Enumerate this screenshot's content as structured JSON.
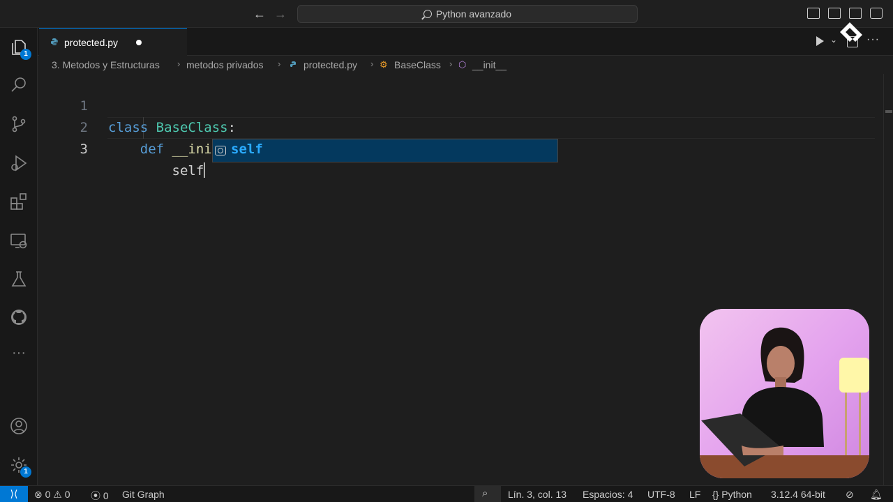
{
  "titlebar": {
    "search_text": "Python avanzado",
    "back_icon": "arrow-left-icon",
    "forward_icon": "arrow-right-icon"
  },
  "activity_bar": {
    "items": [
      {
        "name": "explorer-icon",
        "badge": "1"
      },
      {
        "name": "search-icon"
      },
      {
        "name": "source-control-icon"
      },
      {
        "name": "run-debug-icon"
      },
      {
        "name": "extensions-icon"
      },
      {
        "name": "remote-explorer-icon"
      },
      {
        "name": "testing-icon"
      },
      {
        "name": "github-icon"
      },
      {
        "name": "more-icon",
        "label": "···"
      }
    ],
    "bottom": [
      {
        "name": "accounts-icon"
      },
      {
        "name": "manage-gear-icon",
        "badge": "1"
      }
    ]
  },
  "tabs": [
    {
      "label": "protected.py",
      "dirty": true
    }
  ],
  "breadcrumb": {
    "items": [
      "3. Metodos y Estructuras",
      "metodos privados",
      "protected.py",
      "BaseClass",
      "__init__"
    ]
  },
  "editor": {
    "lines": [
      {
        "number": "1",
        "tokens": [
          [
            "k",
            "class"
          ],
          [
            "txt",
            " "
          ],
          [
            "cls",
            "BaseClass"
          ],
          [
            "txt",
            ":"
          ]
        ]
      },
      {
        "number": "2",
        "tokens": [
          [
            "txt",
            "    "
          ],
          [
            "k",
            "def"
          ],
          [
            "txt",
            " "
          ],
          [
            "fn",
            "__init__"
          ],
          [
            "br",
            "("
          ],
          [
            "par",
            "self"
          ],
          [
            "br",
            ")"
          ],
          [
            "txt",
            ":"
          ]
        ]
      },
      {
        "number": "3",
        "tokens": [
          [
            "txt",
            "        "
          ],
          [
            "par",
            "self"
          ]
        ]
      }
    ],
    "active_line": "3"
  },
  "suggest": {
    "match": "self",
    "rest": "",
    "kind_icon": "variable-icon"
  },
  "statusbar": {
    "errors": "0",
    "warnings": "0",
    "ports": "0",
    "git_graph": "Git Graph",
    "position": "Lín. 3, col. 13",
    "spaces": "Espacios: 4",
    "encoding": "UTF-8",
    "eol": "LF",
    "language": "Python",
    "interpreter": "3.12.4 64-bit"
  },
  "colors": {
    "accent": "#0078d4",
    "keyword": "#569cd6",
    "class": "#4ec9b0",
    "function": "#dcdcaa",
    "parameter": "#9cdcfe",
    "bracket": "#da70d6",
    "suggest_highlight": "#04395e"
  }
}
